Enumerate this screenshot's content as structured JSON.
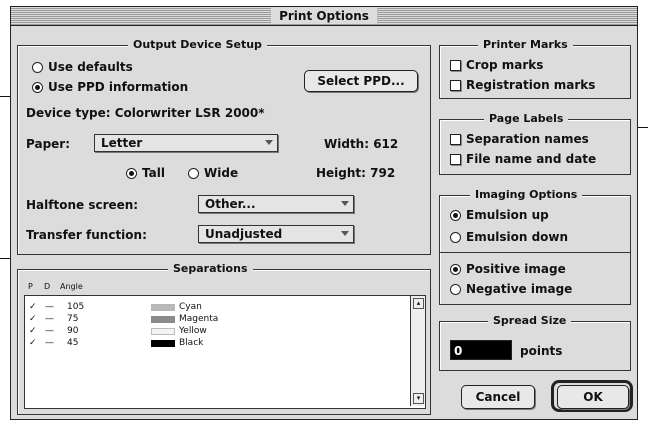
{
  "title": "Print Options",
  "output": {
    "legend": "Output Device Setup",
    "use_defaults": "Use defaults",
    "use_ppd": "Use PPD information",
    "select_ppd": "Select PPD...",
    "device_type": "Device type: Colorwriter LSR 2000*",
    "paper_label": "Paper:",
    "paper_value": "Letter",
    "width": "Width: 612",
    "height": "Height: 792",
    "tall": "Tall",
    "wide": "Wide",
    "halftone_label": "Halftone screen:",
    "halftone_value": "Other...",
    "transfer_label": "Transfer function:",
    "transfer_value": "Unadjusted"
  },
  "separations": {
    "legend": "Separations",
    "headers": [
      "P",
      "D",
      "Angle"
    ],
    "rows": [
      {
        "angle": "105",
        "name": "Cyan",
        "color": "#b8b8b8"
      },
      {
        "angle": "75",
        "name": "Magenta",
        "color": "#8a8a8a"
      },
      {
        "angle": "90",
        "name": "Yellow",
        "color": "#f4f4f4"
      },
      {
        "angle": "45",
        "name": "Black",
        "color": "#000000"
      }
    ]
  },
  "printer_marks": {
    "legend": "Printer Marks",
    "crop": "Crop marks",
    "registration": "Registration marks"
  },
  "page_labels": {
    "legend": "Page Labels",
    "separation_names": "Separation names",
    "file_name_date": "File name and date"
  },
  "imaging": {
    "legend": "Imaging Options",
    "emulsion_up": "Emulsion up",
    "emulsion_down": "Emulsion down",
    "positive": "Positive image",
    "negative": "Negative image"
  },
  "spread": {
    "legend": "Spread Size",
    "value": "0",
    "unit": "points"
  },
  "buttons": {
    "cancel": "Cancel",
    "ok": "OK"
  }
}
